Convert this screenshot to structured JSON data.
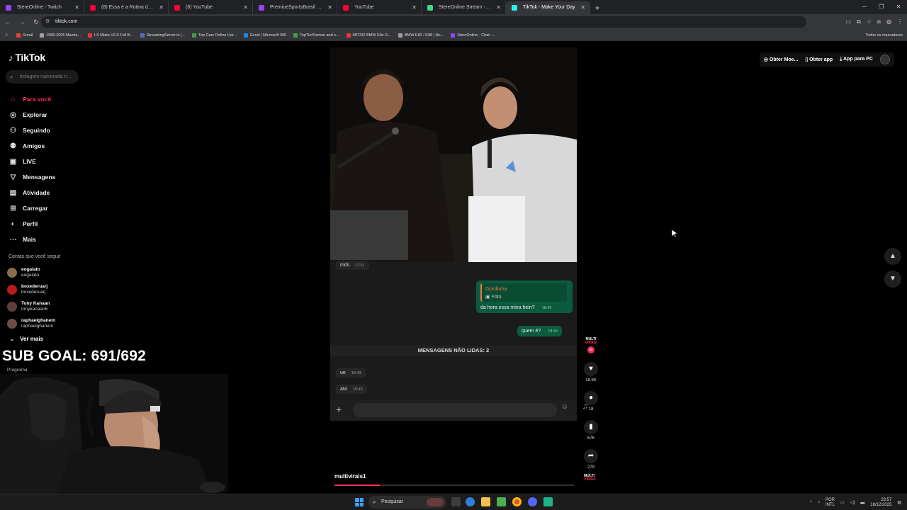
{
  "browser": {
    "tabs": [
      {
        "title": "StereOnline - Twitch",
        "color": "#9146ff",
        "active": false
      },
      {
        "title": "(8) Essa é a Rotina de Motorista...",
        "color": "#ff0033",
        "active": false
      },
      {
        "title": "(8) YouTube",
        "color": "#ff0033",
        "active": false
      },
      {
        "title": "PremioeSportsBrasil - Twitch",
        "color": "#9146ff",
        "active": false
      },
      {
        "title": "YouTube",
        "color": "#ff0033",
        "active": false
      },
      {
        "title": "StereOnline Stream - Watch Li...",
        "color": "#3ddc84",
        "active": false
      },
      {
        "title": "TikTok - Make Your Day",
        "color": "#25f4ee",
        "active": true
      }
    ],
    "url": "tiktok.com",
    "bookmarks": [
      {
        "label": "Gmail",
        "color": "#ea4335"
      },
      {
        "label": "1989-2005 Mazda...",
        "color": "#9e9e9e"
      },
      {
        "label": "LS Miata V2.0 Full B...",
        "color": "#e53935"
      },
      {
        "label": "StreamingServer.io |...",
        "color": "#5c6bc0"
      },
      {
        "label": "Top Cars Online Hor...",
        "color": "#43a047"
      },
      {
        "label": "Excel | Microsoft 365",
        "color": "#1e88e5"
      },
      {
        "label": "TopTierRamen and s...",
        "color": "#43a047"
      },
      {
        "label": "MFD32 BMW E8x G...",
        "color": "#e53935"
      },
      {
        "label": "BMW E82 / E88 | No...",
        "color": "#9e9e9e"
      },
      {
        "label": "StereOnline - Chat -...",
        "color": "#9146ff"
      }
    ],
    "bookmarks_all": "Todos os marcadores"
  },
  "tiktok": {
    "logo": "TikTok",
    "search_placeholder": "trolagem namorada n...",
    "nav": [
      {
        "label": "Para você",
        "icon": "home-icon",
        "glyph": "⌂",
        "active": true
      },
      {
        "label": "Explorar",
        "icon": "compass-icon",
        "glyph": "◎",
        "active": false
      },
      {
        "label": "Seguindo",
        "icon": "following-icon",
        "glyph": "⚇",
        "active": false
      },
      {
        "label": "Amigos",
        "icon": "friends-icon",
        "glyph": "⚉",
        "active": false
      },
      {
        "label": "LIVE",
        "icon": "live-icon",
        "glyph": "▣",
        "active": false
      },
      {
        "label": "Mensagens",
        "icon": "messages-icon",
        "glyph": "▽",
        "active": false
      },
      {
        "label": "Atividade",
        "icon": "activity-icon",
        "glyph": "▤",
        "active": false
      },
      {
        "label": "Carregar",
        "icon": "upload-icon",
        "glyph": "⊞",
        "active": false
      },
      {
        "label": "Perfil",
        "icon": "profile-icon",
        "glyph": "◐",
        "active": false
      },
      {
        "label": "Mais",
        "icon": "more-icon",
        "glyph": "⋯",
        "active": false
      }
    ],
    "following_heading": "Contas que você segue",
    "following": [
      {
        "name": "eogalato",
        "handle": "eogalato",
        "avatar": "#8a6d4b"
      },
      {
        "name": "boxederuarj",
        "handle": "boxederuarj",
        "avatar": "#b71c1c"
      },
      {
        "name": "Tony Kanaan",
        "handle": "tonykanaan6",
        "avatar": "#5d4037"
      },
      {
        "name": "raphaelghanem",
        "handle": "raphaelghanem",
        "avatar": "#6d4c41"
      }
    ],
    "see_more": "Ver mais",
    "top_actions": {
      "coins": "Obter Moe...",
      "get_app": "Obter app",
      "pc_app": "App para PC"
    },
    "chat": {
      "msg_top": {
        "text": "mds",
        "time": "17:11"
      },
      "reply_name": "Gordinha",
      "reply_photo": "Foto",
      "out1": {
        "text": "da hora essa mina hein?",
        "time": "18:42"
      },
      "out2": {
        "text": "quem é?",
        "time": "18:42"
      },
      "unread": "MENSAGENS NÃO LIDAS: 2",
      "in1": {
        "text": "ue",
        "time": "18:43"
      },
      "in2": {
        "text": "ata",
        "time": "18:43"
      }
    },
    "author_badge_top": "MULTI",
    "author_badge_bottom": "VIRAIS",
    "counts": {
      "likes": "18.6K",
      "comments": "18",
      "saves": "676",
      "shares": "279"
    },
    "username": "multivirais1",
    "progress": 0.19
  },
  "stream": {
    "sub_goal": "SUB GOAL: 691/692",
    "program_label": "Programa"
  },
  "taskbar": {
    "search": "Pesquisar",
    "lang_top": "POR",
    "lang_bottom": "INTL",
    "time": "23:57",
    "date": "18/12/2025"
  }
}
